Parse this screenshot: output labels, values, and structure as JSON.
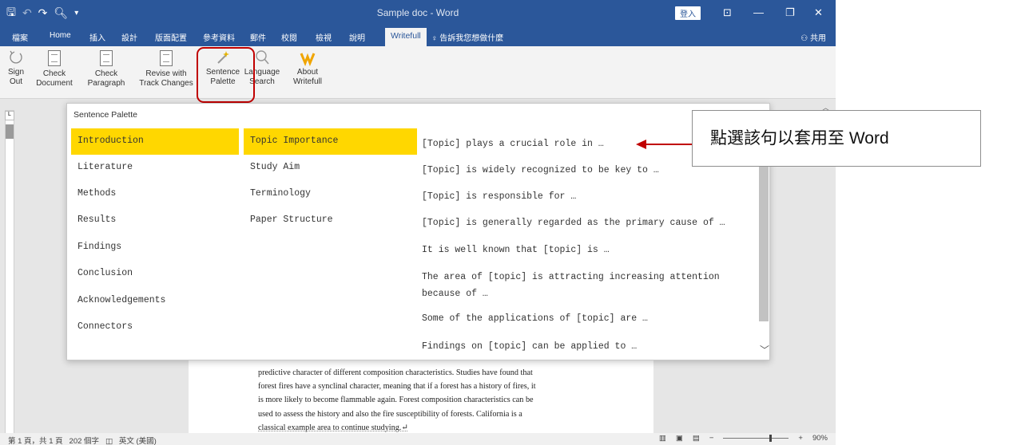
{
  "window": {
    "title": "Sample doc  -  Word",
    "signin_label": "登入",
    "controls": [
      "⊡",
      "—",
      "❐",
      "✕"
    ]
  },
  "qat": {
    "save": "🖫",
    "undo": "↶",
    "redo": "↷",
    "preview": "🔍︎",
    "more": "▾"
  },
  "tabs": [
    "檔案",
    "Home",
    "插入",
    "設計",
    "版面配置",
    "參考資料",
    "郵件",
    "校閱",
    "檢視",
    "說明",
    "Writefull"
  ],
  "active_tab": "Writefull",
  "tell_me": "告訴我您想做什麼",
  "share": "共用",
  "ribbon": {
    "sign_out": [
      "Sign",
      "Out"
    ],
    "check_document": [
      "Check",
      "Document"
    ],
    "check_paragraph": [
      "Check",
      "Paragraph"
    ],
    "revise": [
      "Revise with",
      "Track Changes"
    ],
    "sentence_palette": [
      "Sentence",
      "Palette"
    ],
    "language_search": [
      "Language",
      "Search"
    ],
    "about": [
      "About",
      "Writefull"
    ]
  },
  "palette": {
    "title": "Sentence Palette",
    "sections": [
      "Introduction",
      "Literature",
      "Methods",
      "Results",
      "Findings",
      "Conclusion",
      "Acknowledgements",
      "Connectors"
    ],
    "selected_section": "Introduction",
    "subsections": [
      "Topic Importance",
      "Study Aim",
      "Terminology",
      "Paper Structure"
    ],
    "selected_subsection": "Topic Importance",
    "sentences": [
      "[Topic] plays a crucial role in …",
      "[Topic] is widely recognized to be key to …",
      "[Topic] is responsible for …",
      "[Topic] is generally regarded as the primary cause of …",
      "It is well known that [topic] is …",
      "The area of [topic] is attracting increasing attention because of …",
      "Some of the applications of [topic] are …",
      "Findings on [topic] can be applied to …"
    ]
  },
  "callout": {
    "text": "點選該句以套用至  Word"
  },
  "document": {
    "lines": [
      "predictive character of different composition characteristics. Studies have found that",
      "forest fires have a synclinal character, meaning that if a forest has a history of fires, it",
      "is more likely to become flammable again. Forest composition characteristics can be",
      "used to assess the history and also the fire susceptibility of forests. California is a",
      "classical example area to continue studying.↵"
    ]
  },
  "status": {
    "page": "第 1 頁，共 1 頁",
    "words": "202 個字",
    "language": "英文 (美國)",
    "zoom": "90%"
  },
  "colors": {
    "word_blue": "#2b579a",
    "highlight_yellow": "#ffd700",
    "callout_red": "#c00000"
  }
}
